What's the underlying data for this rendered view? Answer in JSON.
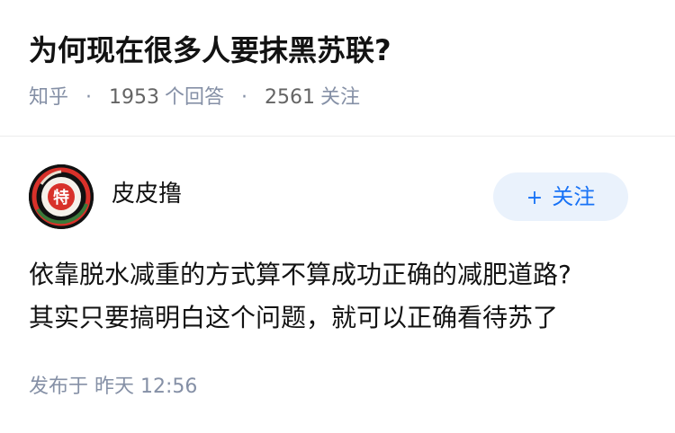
{
  "question": {
    "title": "为何现在很多人要抹黑苏联?",
    "source": "知乎",
    "answers_count": "1953",
    "answers_label": "个回答",
    "followers_count": "2561",
    "followers_label": "关注",
    "separator": "·"
  },
  "answer": {
    "author_name": "皮皮撸",
    "avatar_icon": "red-emblem-avatar",
    "avatar_char": "特",
    "follow_button": {
      "plus": "+",
      "label": "关注"
    },
    "content_lines": [
      "依靠脱水减重的方式算不算成功正确的减肥道路?",
      "其实只要搞明白这个问题，就可以正确看待苏了"
    ],
    "post_time_label": "发布于",
    "post_time": "昨天 12:56"
  },
  "colors": {
    "text_primary": "#121212",
    "text_meta": "#8590a6",
    "accent_blue": "#1772f6",
    "follow_bg": "#eaf2fc",
    "avatar_red": "#d8312a"
  }
}
